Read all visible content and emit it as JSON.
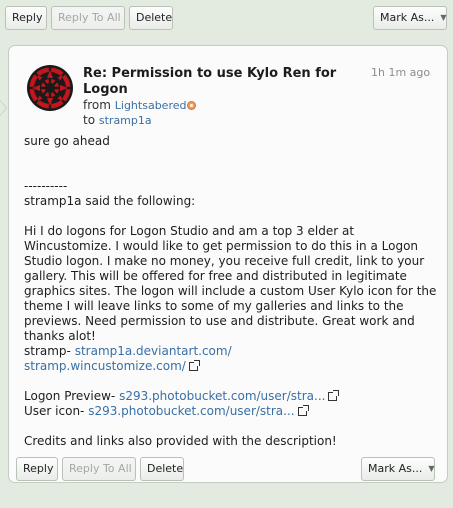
{
  "toolbar": {
    "reply": "Reply",
    "reply_to_all": "Reply To All",
    "delete": "Delete",
    "mark_as": "Mark As..."
  },
  "message": {
    "subject": "Re: Permission to use Kylo Ren for Logon",
    "time": "1h 1m ago",
    "from_label": "from",
    "from_user": "Lightsabered",
    "to_label": "to",
    "to_user": "stramp1a",
    "avatar_icon": "first-order-emblem-icon",
    "body": {
      "reply_text": "sure go ahead",
      "divider": "----------",
      "quote_intro": "stramp1a said the following:",
      "quote_para": "Hi I do logons for Logon Studio and am a top 3 elder at Wincustomize. I would like to get permission to do this in a Logon Studio logon. I make no money, you receive full credit, link to your gallery. This will be offered for free and distributed in legitimate graphics sites. The logon will include a custom User Kylo icon for the theme I will leave links to some of my galleries and links to the previews. Need permission to use and distribute. Great work and thanks alot!",
      "stramp_label": "stramp- ",
      "stramp_link": "stramp1a.deviantart.com/",
      "wc_link": "stramp.wincustomize.com/",
      "preview_label": "Logon Preview- ",
      "preview_link": "s293.photobucket.com/user/stra...",
      "icon_label": "User icon- ",
      "icon_link": "s293.photobucket.com/user/stra...",
      "credits": "Credits and links also provided with the description!"
    }
  },
  "colors": {
    "background": "#e3eae0",
    "link": "#3a6fa6",
    "avatar_red": "#c2161c",
    "badge": "#f29a5c"
  }
}
